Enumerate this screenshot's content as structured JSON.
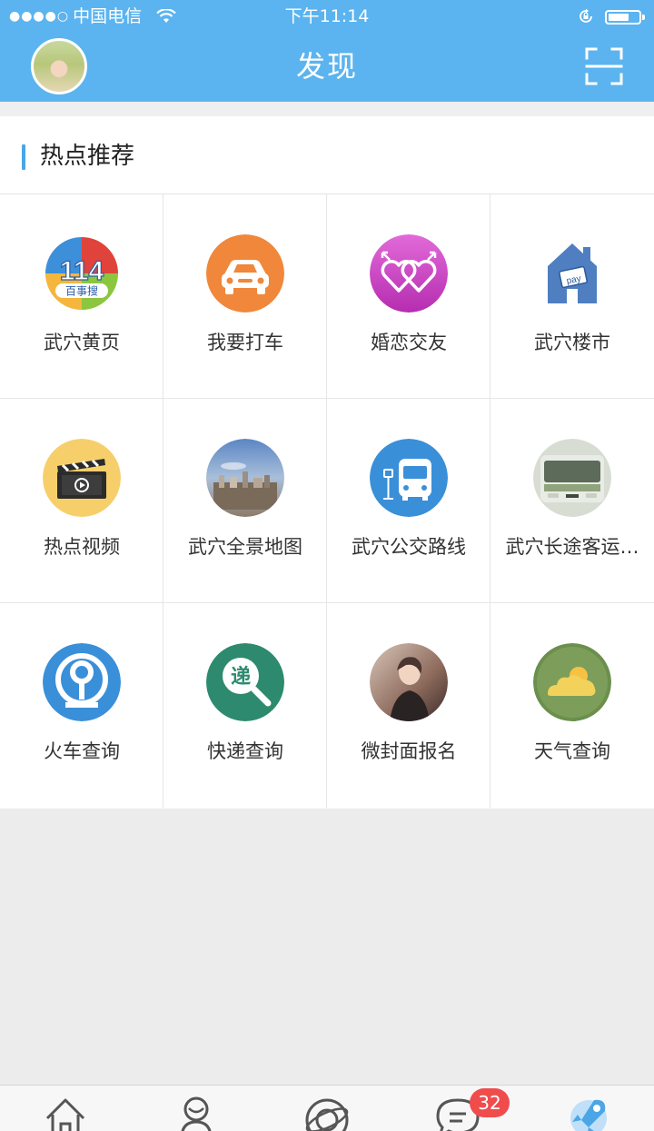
{
  "status_bar": {
    "signal": "●●●●○",
    "carrier": "中国电信",
    "time": "下午11:14"
  },
  "header": {
    "title": "发现"
  },
  "section": {
    "title": "热点推荐"
  },
  "items": [
    {
      "label": "武穴黄页",
      "icon": "yellow-pages-114-icon"
    },
    {
      "label": "我要打车",
      "icon": "taxi-icon"
    },
    {
      "label": "婚恋交友",
      "icon": "dating-hearts-icon"
    },
    {
      "label": "武穴楼市",
      "icon": "house-pay-icon"
    },
    {
      "label": "热点视频",
      "icon": "video-clapper-icon"
    },
    {
      "label": "武穴全景地图",
      "icon": "panorama-map-photo-icon"
    },
    {
      "label": "武穴公交路线",
      "icon": "bus-stop-icon"
    },
    {
      "label": "武穴长途客运…",
      "icon": "coach-bus-photo-icon"
    },
    {
      "label": "火车查询",
      "icon": "railway-logo-icon"
    },
    {
      "label": "快递查询",
      "icon": "express-search-icon"
    },
    {
      "label": "微封面报名",
      "icon": "cover-photo-icon"
    },
    {
      "label": "天气查询",
      "icon": "weather-cloud-sun-icon"
    }
  ],
  "tabbar": {
    "tabs": [
      "home-icon",
      "contacts-icon",
      "discover-planet-icon",
      "messages-icon",
      "rocket-icon"
    ],
    "messages_badge": "32"
  },
  "colors": {
    "header_bg": "#5bb4ef",
    "accent": "#4aa6e6",
    "badge": "#f04c4c"
  }
}
